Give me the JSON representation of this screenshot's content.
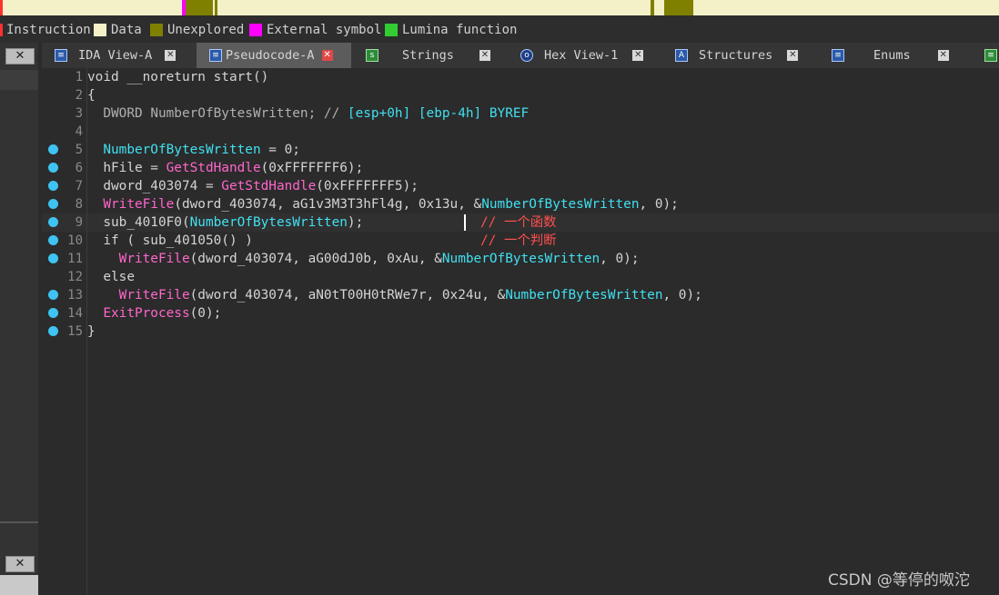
{
  "legend": {
    "instruction": "Instruction",
    "data": "Data",
    "unexplored": "Unexplored",
    "external_symbol": "External symbol",
    "lumina_function": "Lumina function",
    "colors": {
      "data": "#f4f0c8",
      "unexplored": "#7f7f00",
      "external_symbol": "#ff00ff",
      "lumina_function": "#33cc33"
    }
  },
  "tabs": [
    {
      "label": "IDA View-A",
      "icon": "ida-view-icon"
    },
    {
      "label": "Pseudocode-A",
      "icon": "pseudocode-icon"
    },
    {
      "label": "Strings",
      "icon": "strings-icon"
    },
    {
      "label": "Hex View-1",
      "icon": "hex-view-icon"
    },
    {
      "label": "Structures",
      "icon": "structures-icon"
    },
    {
      "label": "Enums",
      "icon": "enums-icon"
    }
  ],
  "close_glyph": "✕",
  "code": {
    "line_numbers": [
      "1",
      "2",
      "3",
      "4",
      "5",
      "6",
      "7",
      "8",
      "9",
      "10",
      "11",
      "12",
      "13",
      "14",
      "15"
    ],
    "l1": {
      "a": "void __noreturn ",
      "b": "start",
      "c": "()"
    },
    "l2": "{",
    "l3": {
      "a": "  DWORD ",
      "b": "NumberOfBytesWritten",
      "c": "; // ",
      "d": "[esp+0h] [ebp-4h] BYREF"
    },
    "l5": {
      "a": "  ",
      "b": "NumberOfBytesWritten",
      "c": " = 0;"
    },
    "l6": {
      "a": "  hFile = ",
      "b": "GetStdHandle",
      "c": "(0xFFFFFFF6);"
    },
    "l7": {
      "a": "  dword_403074 = ",
      "b": "GetStdHandle",
      "c": "(0xFFFFFFF5);"
    },
    "l8": {
      "a": "  ",
      "b": "WriteFile",
      "c": "(dword_403074, aG1v3M3T3hFl4g, 0x13u, &",
      "d": "NumberOfBytesWritten",
      "e": ", 0);"
    },
    "l9": {
      "a": "  sub_4010F0(",
      "b": "NumberOfBytesWritten",
      "c": ");",
      "comment": "// 一个函数"
    },
    "l10": {
      "a": "  if ( sub_401050() )",
      "comment": "// 一个判断"
    },
    "l11": {
      "a": "    ",
      "b": "WriteFile",
      "c": "(dword_403074, aG00dJ0b, 0xAu, &",
      "d": "NumberOfBytesWritten",
      "e": ", 0);"
    },
    "l12": "  else",
    "l13": {
      "a": "    ",
      "b": "WriteFile",
      "c": "(dword_403074, aN0tT00H0tRWe7r, 0x24u, &",
      "d": "NumberOfBytesWritten",
      "e": ", 0);"
    },
    "l14": {
      "a": "  ",
      "b": "ExitProcess",
      "c": "(0);"
    },
    "l15": "}"
  },
  "watermark": "CSDN @等停的呶沱"
}
